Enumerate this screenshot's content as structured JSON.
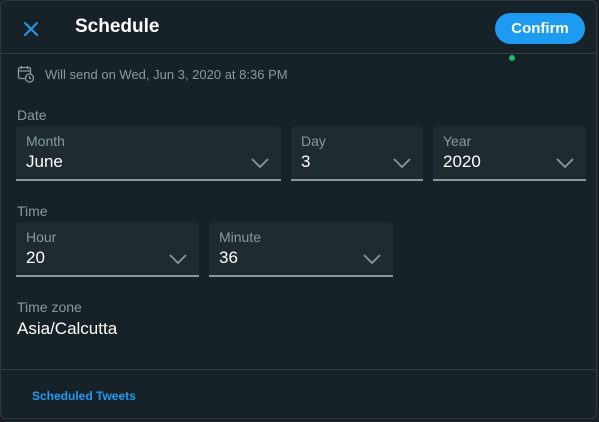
{
  "header": {
    "title": "Schedule",
    "confirm_label": "Confirm"
  },
  "send_info": "Will send on Wed, Jun 3, 2020 at 8:36 PM",
  "date": {
    "section_label": "Date",
    "month": {
      "label": "Month",
      "value": "June"
    },
    "day": {
      "label": "Day",
      "value": "3"
    },
    "year": {
      "label": "Year",
      "value": "2020"
    }
  },
  "time": {
    "section_label": "Time",
    "hour": {
      "label": "Hour",
      "value": "20"
    },
    "minute": {
      "label": "Minute",
      "value": "36"
    }
  },
  "timezone": {
    "label": "Time zone",
    "value": "Asia/Calcutta"
  },
  "footer": {
    "link": "Scheduled Tweets"
  },
  "colors": {
    "accent": "#1d9bf0",
    "status_dot": "#17bf63",
    "background": "#172228"
  },
  "icons": {
    "close": "close-icon",
    "calendar": "calendar-clock-icon",
    "chevron": "chevron-down-icon"
  }
}
